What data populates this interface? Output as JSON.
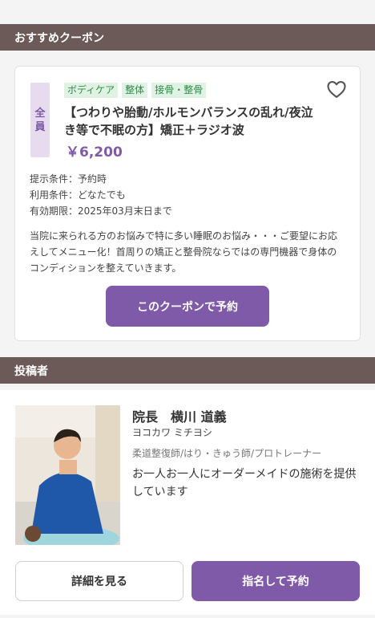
{
  "sections": {
    "recommended_coupon": "おすすめクーポン",
    "poster": "投稿者"
  },
  "coupon": {
    "target_badge": "全員",
    "tags": [
      "ボディケア",
      "整体",
      "接骨・整骨"
    ],
    "title": "【つわりや胎動/ホルモンバランスの乱れ/夜泣き等で不眠の方】矯正＋ラジオ波",
    "price": "￥6,200",
    "conditions": {
      "presentation": "提示条件：予約時",
      "usage": "利用条件：どなたでも",
      "expiry": "有効期限：2025年03月末日まで"
    },
    "description": "当院に来られる方のお悩みで特に多い睡眠のお悩み・・・ご要望にお応えしてメニュー化！首周りの矯正と整骨院ならではの専門機器で身体のコンディションを整えていきます。",
    "reserve_button": "このクーポンで予約",
    "favorite_icon": "heart-icon"
  },
  "poster": {
    "name": "院長　横川 道義",
    "kana": "ヨコカワ ミチヨシ",
    "roles": "柔道整復師/はり・きゅう師/プロトレーナー",
    "message": "お一人お一人にオーダーメイドの施術を提供しています",
    "detail_button": "詳細を見る",
    "nominate_button": "指名して予約"
  },
  "colors": {
    "accent": "#7f5aa8",
    "header_bg": "#6b5a57",
    "tag_bg": "#dff2e4",
    "tag_text": "#2f8a4a"
  }
}
